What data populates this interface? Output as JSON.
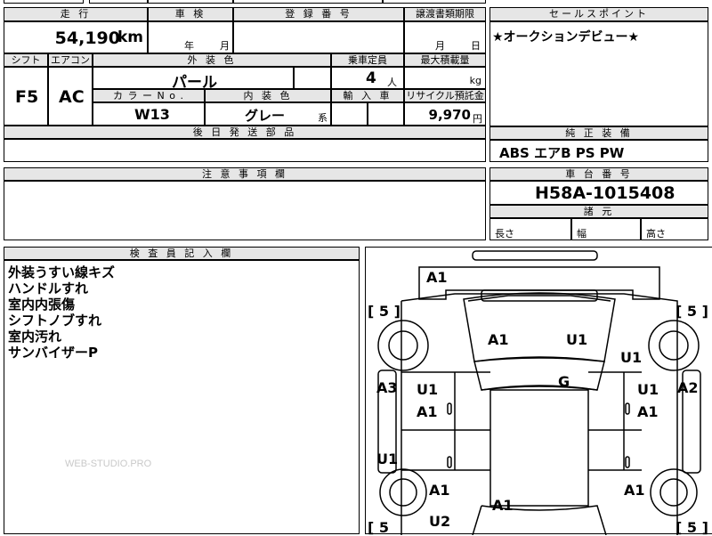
{
  "top_fragment": "西 暦 年",
  "mileage": {
    "header": "走 行",
    "value": "54,190",
    "unit": "km"
  },
  "shaken": {
    "header": "車 検",
    "year_label": "年",
    "month_label": "月"
  },
  "registration": {
    "header": "登 録 番 号"
  },
  "transfer": {
    "header": "譲渡書類期限",
    "month_label": "月",
    "day_label": "日"
  },
  "sales_point": {
    "header": "セールスポイント",
    "text": "★オークションデビュー★"
  },
  "shift": {
    "header": "シフト",
    "value": "F5"
  },
  "aircon": {
    "header": "エアコン",
    "value": "AC"
  },
  "exterior_color": {
    "header": "外 装 色",
    "value": "パール"
  },
  "capacity": {
    "header": "乗車定員",
    "value": "4",
    "unit": "人"
  },
  "max_load": {
    "header": "最大積載量",
    "unit": "kg"
  },
  "color_no": {
    "header": "カ ラ ー N o .",
    "value": "W13"
  },
  "interior_color": {
    "header": "内 装 色",
    "value": "グレー",
    "suffix": "系"
  },
  "import_car": {
    "header": "輸 入 車"
  },
  "recycle": {
    "header": "リサイクル預託金",
    "value": "9,970",
    "unit": "円"
  },
  "later_parts": {
    "header": "後 日 発 送 部 品"
  },
  "equipment": {
    "header": "純 正 装 備",
    "value": "ABS エアB PS PW"
  },
  "caution": {
    "header": "注 意 事 項 欄"
  },
  "chassis": {
    "header": "車 台 番 号",
    "value": "H58A-1015408"
  },
  "dimensions": {
    "header": "諸 元",
    "length": "長さ",
    "width": "幅",
    "height": "高さ"
  },
  "inspector": {
    "header": "検 査 員 記 入 欄",
    "notes": [
      "外装うすい線キズ",
      "ハンドルすれ",
      "室内内張傷",
      "シフトノブすれ",
      "室内汚れ",
      "サンバイザーP"
    ]
  },
  "watermark": "WEB-STUDIO.PRO",
  "diagram": {
    "marks": {
      "front_bumper": "A1",
      "hood_left": "A1",
      "hood_right": "U1",
      "right_front_fender": "U1",
      "left_front_fender": "A3",
      "right_front_fender_side": "A2",
      "roof": "G",
      "left_door_upper": "U1",
      "left_door_lower": "A1",
      "right_door_upper": "U1",
      "right_door_lower": "A1",
      "left_rear_side": "U1",
      "left_rear_quarter": "A1",
      "right_rear_quarter": "A1",
      "trunk": "A1",
      "rear_left": "U2"
    },
    "brackets": {
      "left_front": "[ 5 ]",
      "right_front": "[ 5 ]",
      "left_rear": "[ 5",
      "right_rear": "[ 5 ]"
    }
  }
}
